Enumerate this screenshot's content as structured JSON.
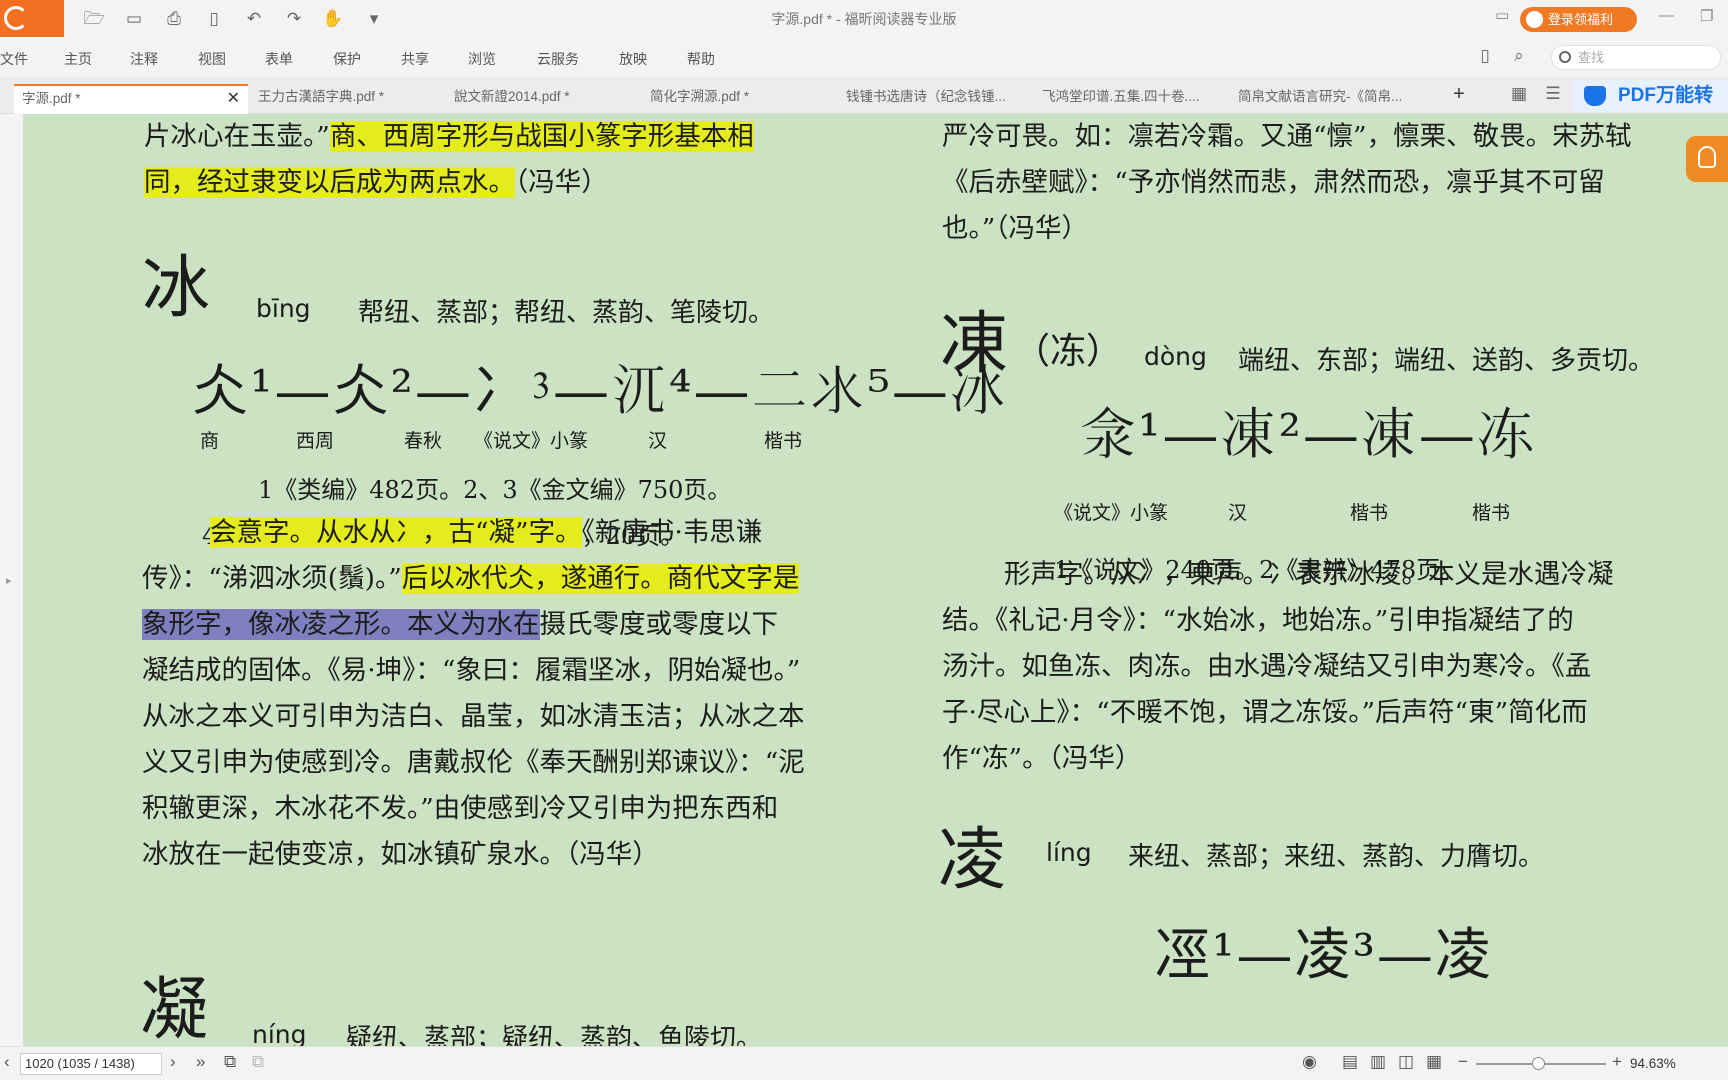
{
  "window": {
    "title": "字源.pdf * - 福昕阅读器专业版",
    "login": "登录领福利"
  },
  "menu": [
    "文件",
    "主页",
    "注释",
    "视图",
    "表单",
    "保护",
    "共享",
    "浏览",
    "云服务",
    "放映",
    "帮助"
  ],
  "search": {
    "placeholder": "查找"
  },
  "tabs": [
    "字源.pdf *",
    "王力古漢語字典.pdf *",
    "說文新證2014.pdf *",
    "简化字溯源.pdf *",
    "钱锺书选唐诗（纪念钱锺...",
    "飞鸿堂印谱.五集.四十卷....",
    "简帛文献语言研究-《简帛..."
  ],
  "banner": "PDF万能转",
  "left": {
    "p0a": "片冰心在玉壶。”",
    "p0b": "商、西周字形与战国小篆字形基本相",
    "p1a": "同，经过隶变以后成为两点水。",
    "p1b": "（冯华）",
    "bing": {
      "char": "冰",
      "pinyin": "bīng",
      "fanqie": "帮纽、蒸部；帮纽、蒸韵、笔陵切。",
      "glyphs": "仌¹—仌²—冫⁳—𣲍⁴—二氺⁵—冰",
      "captions": [
        "商",
        "西周",
        "春秋",
        "《说文》小篆",
        "汉",
        "楷书"
      ],
      "note1": "1《类编》482页。2、3《金文编》750页。",
      "note2": "4《说文》240页。5《金石典》卷4，20页。"
    },
    "t1a": "会意字。从水从冫，古“凝”字。",
    "t1b": "《新唐书·韦思谦",
    "t2a": "传》：“涕泗冰须(鬚)。”",
    "t2b": "后以冰代仌，遂通行。商代文字是",
    "t3a": "象形字，像冰凌之形。本义为水在",
    "t3b": "摄氏零度或零度以下",
    "t4": "凝结成的固体。《易·坤》：“象曰：履霜坚冰，阴始凝也。”",
    "t5": "从冰之本义可引申为洁白、晶莹，如冰清玉洁；从冰之本",
    "t6": "义又引申为使感到冷。唐戴叔伦《奉天酬别郑谏议》：“泥",
    "t7": "积辙更深，木冰花不发。”由使感到冷又引申为把东西和",
    "t8": "冰放在一起使变凉，如冰镇矿泉水。（冯华）",
    "ning": {
      "char": "凝",
      "pinyin": "níng",
      "fanqie": "疑纽、蒸部；疑纽、蒸韵、鱼陵切。"
    }
  },
  "right": {
    "r0": "严冷可畏。如：凛若冷霜。又通“懔”，懔栗、敬畏。宋苏轼",
    "r1": "《后赤壁赋》：“予亦悄然而悲，肃然而恐，凛乎其不可留",
    "r2": "也。”（冯华）",
    "dong": {
      "char": "凍",
      "sub": "（冻）",
      "pinyin": "dòng",
      "fanqie": "端纽、东部；端纽、送韵、多贡切。",
      "glyphs": "𣲎¹—凍²—凍—冻",
      "captions": [
        "《说文》小篆",
        "汉",
        "楷书",
        "楷书"
      ],
      "note": "1《说文》240页。2《隶辨》478页。"
    },
    "s1": "形声字。从冫，東声。冫表示冰凌。本义是水遇冷凝",
    "s2": "结。《礼记·月令》：“水始冰，地始冻。”引申指凝结了的",
    "s3": "汤汁。如鱼冻、肉冻。由水遇冷凝结又引申为寒冷。《孟",
    "s4": "子·尽心上》：“不暖不饱，谓之冻馁。”后声符“東”简化而",
    "s5": "作“冻”。（冯华）",
    "ling": {
      "char": "凌",
      "pinyin": "líng",
      "fanqie": "来纽、蒸部；来纽、蒸韵、力膺切。",
      "glyphs": "𠗊¹—凌³—凌"
    }
  },
  "status": {
    "page": "1020 (1035 / 1438)",
    "zoom": "94.63%"
  }
}
